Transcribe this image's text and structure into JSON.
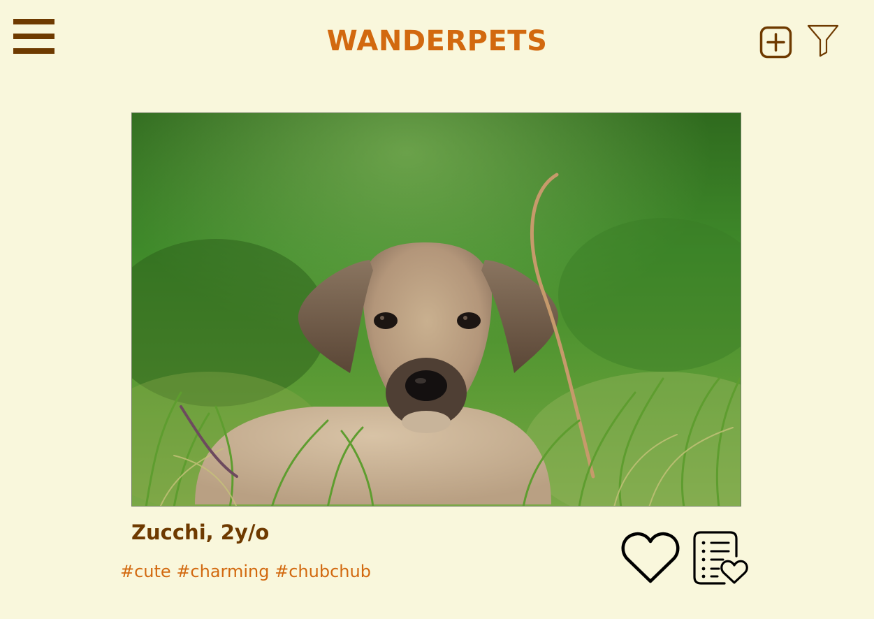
{
  "header": {
    "title": "WANDERPETS",
    "menu_icon": "hamburger-menu-icon",
    "add_icon": "add-square-icon",
    "filter_icon": "filter-funnel-icon",
    "accent_color": "#d2690f",
    "dark_color": "#6e3a00",
    "background_color": "#f9f7dc"
  },
  "pet": {
    "name_age": "Zucchi, 2y/o",
    "tags": "#cute #charming #chubchub"
  },
  "actions": {
    "like_icon": "heart-outline-icon",
    "adopt_icon": "list-heart-icon"
  }
}
